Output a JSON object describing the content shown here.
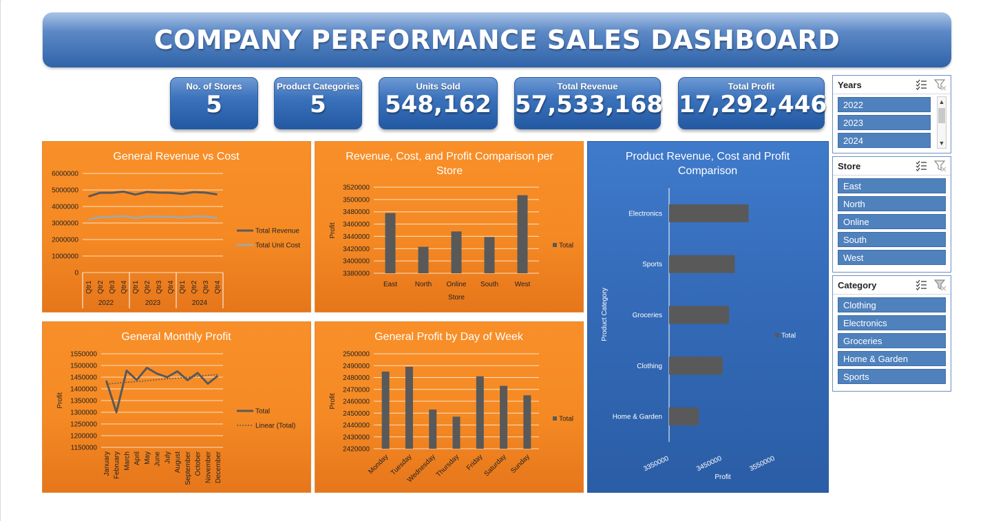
{
  "dashboard": {
    "title": "COMPANY PERFORMANCE SALES DASHBOARD"
  },
  "kpis": [
    {
      "label": "No. of Stores",
      "value": "5"
    },
    {
      "label": "Product Categories",
      "value": "5"
    },
    {
      "label": "Units Sold",
      "value": "548,162"
    },
    {
      "label": "Total Revenue",
      "value": "57,533,168"
    },
    {
      "label": "Total Profit",
      "value": "17,292,446"
    }
  ],
  "colors": {
    "orange_panel": "#f58a24",
    "blue_panel": "#3369b6",
    "series_dark": "#595959",
    "series_light": "#a6a6a6",
    "slicer_item": "#4f81bd"
  },
  "slicers": {
    "years": {
      "title": "Years",
      "items": [
        "2022",
        "2023",
        "2024"
      ]
    },
    "store": {
      "title": "Store",
      "items": [
        "East",
        "North",
        "Online",
        "South",
        "West"
      ]
    },
    "category": {
      "title": "Category",
      "items": [
        "Clothing",
        "Electronics",
        "Groceries",
        "Home & Garden",
        "Sports"
      ]
    }
  },
  "icons": [
    "multi-select-icon",
    "clear-filter-icon"
  ],
  "chart_data": [
    {
      "type": "line",
      "title": "General Revenue vs Cost",
      "x": [
        "Qtr1",
        "Qtr2",
        "Qtr3",
        "Qtr4",
        "Qtr1",
        "Qtr2",
        "Qtr3",
        "Qtr4",
        "Qtr1",
        "Qtr2",
        "Qtr3",
        "Qtr4"
      ],
      "x_groups": [
        {
          "label": "2022",
          "span": 4
        },
        {
          "label": "2023",
          "span": 4
        },
        {
          "label": "2024",
          "span": 4
        }
      ],
      "ylim": [
        0,
        6000000
      ],
      "yticks": [
        "0",
        "1000000",
        "2000000",
        "3000000",
        "4000000",
        "5000000",
        "6000000"
      ],
      "series": [
        {
          "name": "Total Revenue",
          "color": "#595959",
          "values": [
            4600000,
            4830000,
            4830000,
            4900000,
            4720000,
            4880000,
            4840000,
            4830000,
            4760000,
            4870000,
            4840000,
            4730000
          ]
        },
        {
          "name": "Total Unit Cost",
          "color": "#a6a6a6",
          "values": [
            3200000,
            3350000,
            3360000,
            3420000,
            3300000,
            3400000,
            3370000,
            3380000,
            3320000,
            3400000,
            3380000,
            3300000
          ]
        }
      ],
      "legend": "right"
    },
    {
      "type": "bar",
      "title": "Revenue, Cost, and Profit Comparison per Store",
      "xlabel": "Store",
      "ylabel": "Profit",
      "categories": [
        "East",
        "North",
        "Online",
        "South",
        "West"
      ],
      "ylim": [
        3380000,
        3520000
      ],
      "yticks": [
        "3380000",
        "3400000",
        "3420000",
        "3440000",
        "3460000",
        "3480000",
        "3500000",
        "3520000"
      ],
      "series": [
        {
          "name": "Total",
          "values": [
            3478000,
            3423000,
            3448000,
            3439000,
            3507000
          ]
        }
      ],
      "legend": "right"
    },
    {
      "type": "bar",
      "orientation": "horizontal",
      "title": "Product Revenue, Cost and Profit Comparison",
      "xlabel": "Profit",
      "ylabel": "Product Category",
      "categories": [
        "Electronics",
        "Sports",
        "Groceries",
        "Clothing",
        "Home & Garden"
      ],
      "xlim": [
        3350000,
        3550000
      ],
      "xticks": [
        "3350000",
        "3450000",
        "3550000"
      ],
      "series": [
        {
          "name": "Total",
          "values": [
            3500000,
            3474000,
            3463000,
            3451000,
            3406000
          ]
        }
      ],
      "legend": "right"
    },
    {
      "type": "line",
      "title": "General Monthly Profit",
      "ylabel": "Profit",
      "x": [
        "January",
        "February",
        "March",
        "April",
        "May",
        "June",
        "July",
        "August",
        "September",
        "October",
        "November",
        "December"
      ],
      "ylim": [
        1150000,
        1550000
      ],
      "yticks": [
        "1150000",
        "1200000",
        "1250000",
        "1300000",
        "1350000",
        "1400000",
        "1450000",
        "1500000",
        "1550000"
      ],
      "series": [
        {
          "name": "Total",
          "values": [
            1435000,
            1300000,
            1478000,
            1438000,
            1490000,
            1465000,
            1450000,
            1475000,
            1437000,
            1468000,
            1422000,
            1456000
          ]
        },
        {
          "name": "Linear (Total)",
          "values": [
            1420000,
            1424000,
            1428000,
            1431000,
            1435000,
            1439000,
            1443000,
            1446000,
            1450000,
            1454000,
            1458000,
            1462000
          ],
          "style": "dotted"
        }
      ],
      "legend": "right"
    },
    {
      "type": "bar",
      "title": "General Profit by Day of Week",
      "ylabel": "Profit",
      "categories": [
        "Monday",
        "Tuesday",
        "Wednesday",
        "Thursday",
        "Friday",
        "Saturday",
        "Sunday"
      ],
      "ylim": [
        2420000,
        2500000
      ],
      "yticks": [
        "2420000",
        "2430000",
        "2440000",
        "2450000",
        "2460000",
        "2470000",
        "2480000",
        "2490000",
        "2500000"
      ],
      "series": [
        {
          "name": "Total",
          "values": [
            2485000,
            2489000,
            2453000,
            2447000,
            2481000,
            2473000,
            2465000
          ]
        }
      ],
      "legend": "right"
    }
  ]
}
